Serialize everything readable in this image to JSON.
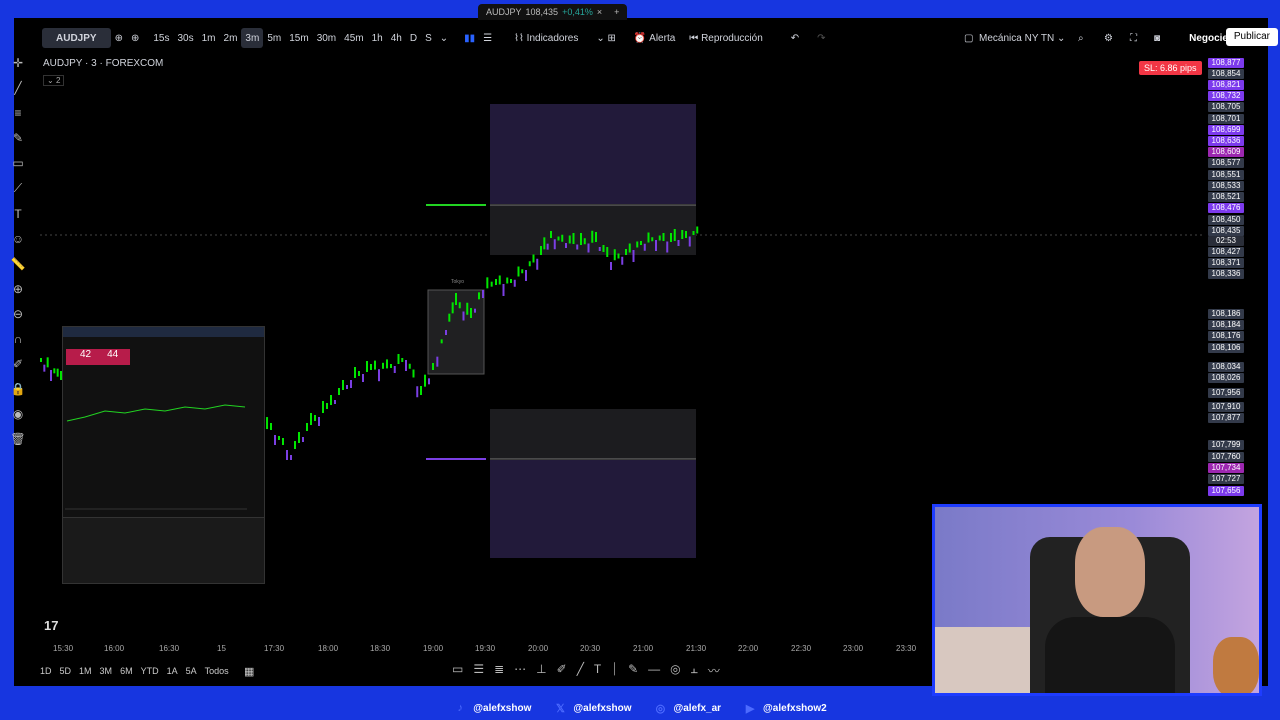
{
  "tab": {
    "symbol": "AUDJPY",
    "price": "108,435",
    "change": "+0,41%",
    "close": "×",
    "new_tab": "+"
  },
  "toolbar": {
    "symbol": "AUDJPY",
    "timeframes": [
      "15s",
      "30s",
      "1m",
      "2m",
      "3m",
      "5m",
      "15m",
      "30m",
      "45m",
      "1h",
      "4h",
      "D",
      "S"
    ],
    "active_timeframe": "3m",
    "indicators_label": "Indicadores",
    "alert_label": "Alerta",
    "replay_label": "Reproducción",
    "layout_name": "Mecánica NY TN",
    "trade_label": "Negocie",
    "publish_label": "Publicar"
  },
  "chart": {
    "legend": "AUDJPY · 3 · FOREXCOM",
    "legend_count": "2",
    "sl_badge": "SL: 6.86 pips",
    "zone_label": "Tokyo",
    "price_labels": [
      {
        "text": "108,877",
        "color": "#7c3aed"
      },
      {
        "text": "108,854",
        "color": "#333a4a"
      },
      {
        "text": "108,821",
        "color": "#7c3aed"
      },
      {
        "text": "108,732",
        "color": "#7c3aed"
      },
      {
        "text": "108,705",
        "color": "#333a4a"
      },
      {
        "text": "108,701",
        "color": "#333a4a"
      },
      {
        "text": "108,699",
        "color": "#7c3aed"
      },
      {
        "text": "108,636",
        "color": "#7c3aed"
      },
      {
        "text": "108,609",
        "color": "#9c27b0"
      },
      {
        "text": "108,577",
        "color": "#333a4a"
      },
      {
        "text": "108,551",
        "color": "#333a4a"
      },
      {
        "text": "108,533",
        "color": "#333a4a"
      },
      {
        "text": "108,521",
        "color": "#333a4a"
      },
      {
        "text": "108,476",
        "color": "#7c3aed"
      },
      {
        "text": "108,450",
        "color": "#333a4a"
      },
      {
        "text": "108,435",
        "color": "#333a4a"
      },
      {
        "text": "02:53",
        "color": "#2a2e39"
      },
      {
        "text": "108,427",
        "color": "#333a4a"
      },
      {
        "text": "108,371",
        "color": "#333a4a"
      },
      {
        "text": "108,336",
        "color": "#333a4a"
      },
      {
        "text": "108,186",
        "color": "#333a4a"
      },
      {
        "text": "108,184",
        "color": "#333a4a"
      },
      {
        "text": "108,176",
        "color": "#333a4a"
      },
      {
        "text": "108,106",
        "color": "#333a4a"
      },
      {
        "text": "108,034",
        "color": "#333a4a"
      },
      {
        "text": "108,026",
        "color": "#333a4a"
      },
      {
        "text": "107,956",
        "color": "#333a4a"
      },
      {
        "text": "107,910",
        "color": "#333a4a"
      },
      {
        "text": "107,877",
        "color": "#333a4a"
      },
      {
        "text": "107,799",
        "color": "#333a4a"
      },
      {
        "text": "107,760",
        "color": "#333a4a"
      },
      {
        "text": "107,734",
        "color": "#9c27b0"
      },
      {
        "text": "107,727",
        "color": "#333a4a"
      },
      {
        "text": "107,656",
        "color": "#7c3aed"
      }
    ],
    "time_labels": [
      "15:30",
      "16:00",
      "16:30",
      "15",
      "17:30",
      "18:00",
      "18:30",
      "19:00",
      "19:30",
      "20:00",
      "20:30",
      "21:00",
      "21:30",
      "22:00",
      "22:30",
      "23:00",
      "23:30"
    ]
  },
  "bottom": {
    "ranges": [
      "1D",
      "5D",
      "1M",
      "3M",
      "6M",
      "YTD",
      "1A",
      "5A",
      "Todos"
    ]
  },
  "socials": [
    {
      "icon": "tiktok-icon",
      "handle": "@alefxshow"
    },
    {
      "icon": "x-icon",
      "handle": "@alefxshow"
    },
    {
      "icon": "instagram-icon",
      "handle": "@alefx_ar"
    },
    {
      "icon": "youtube-icon",
      "handle": "@alefxshow2"
    }
  ],
  "mini_window": {
    "big_left": "42",
    "big_right": "44"
  },
  "colors": {
    "bull": "#00e600",
    "bear": "#7b3fe4",
    "zone": "#2a1f45",
    "accent": "#1e3cff"
  }
}
